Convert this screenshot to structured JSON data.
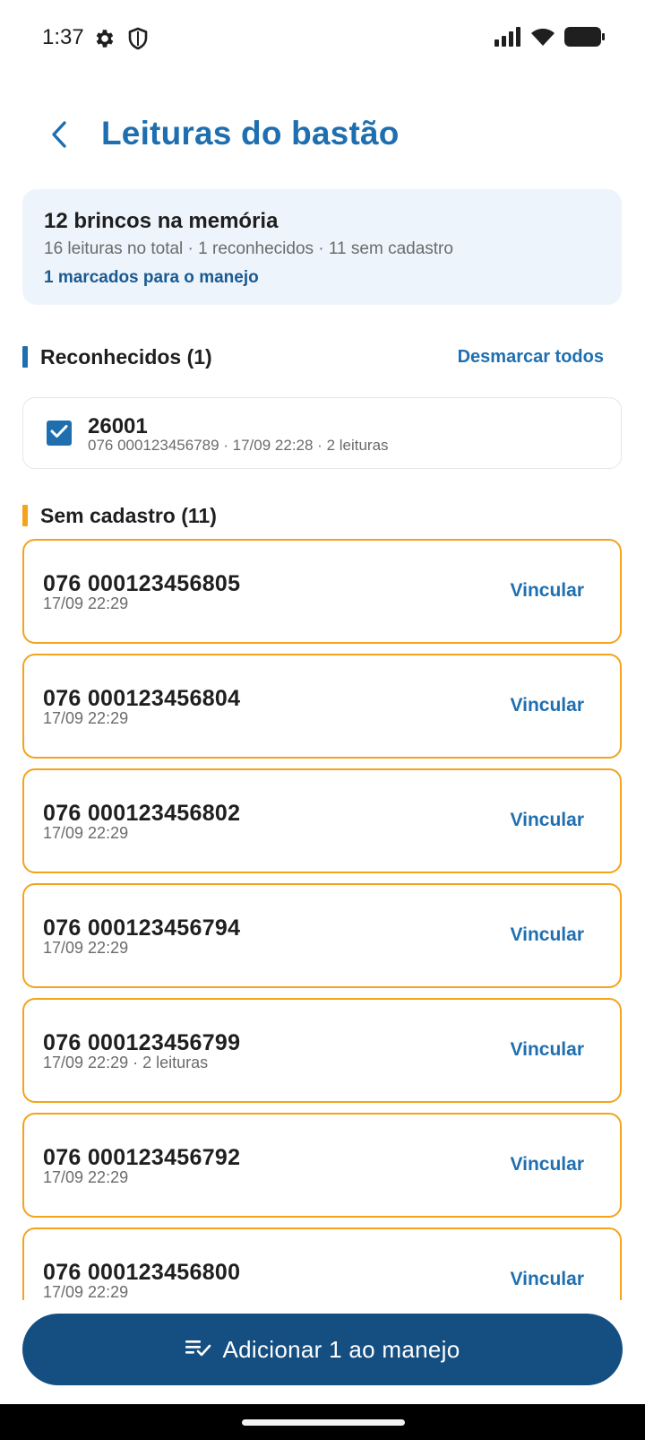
{
  "status_bar": {
    "time": "1:37",
    "icons": [
      "settings-gear-icon",
      "shield-icon",
      "signal-icon",
      "wifi-icon",
      "battery-icon"
    ]
  },
  "header": {
    "back_icon": "chevron-left-icon",
    "title": "Leituras do bastão"
  },
  "summary": {
    "title": "12 brincos na memória",
    "subtitle": "16 leituras no total · 1 reconhecidos · 11 sem cadastro",
    "marked": "1 marcados para o manejo"
  },
  "recognized": {
    "title": "Reconhecidos (1)",
    "unmark_all": "Desmarcar todos",
    "accent_color": "#1f6fb0",
    "items": [
      {
        "name": "26001",
        "detail": "076 000123456789 · 17/09 22:28 · 2 leituras",
        "checked": true
      }
    ]
  },
  "unregistered": {
    "title": "Sem cadastro (11)",
    "accent_color": "#f4a31d",
    "link_label": "Vincular",
    "items": [
      {
        "id": "076 000123456805",
        "detail": "17/09 22:29"
      },
      {
        "id": "076 000123456804",
        "detail": "17/09 22:29"
      },
      {
        "id": "076 000123456802",
        "detail": "17/09 22:29"
      },
      {
        "id": "076 000123456794",
        "detail": "17/09 22:29"
      },
      {
        "id": "076 000123456799",
        "detail": "17/09 22:29 · 2 leituras"
      },
      {
        "id": "076 000123456792",
        "detail": "17/09 22:29"
      },
      {
        "id": "076 000123456800",
        "detail": "17/09 22:29"
      }
    ]
  },
  "action": {
    "icon": "playlist-add-check-icon",
    "label": "Adicionar 1 ao manejo",
    "color": "#154f82"
  }
}
